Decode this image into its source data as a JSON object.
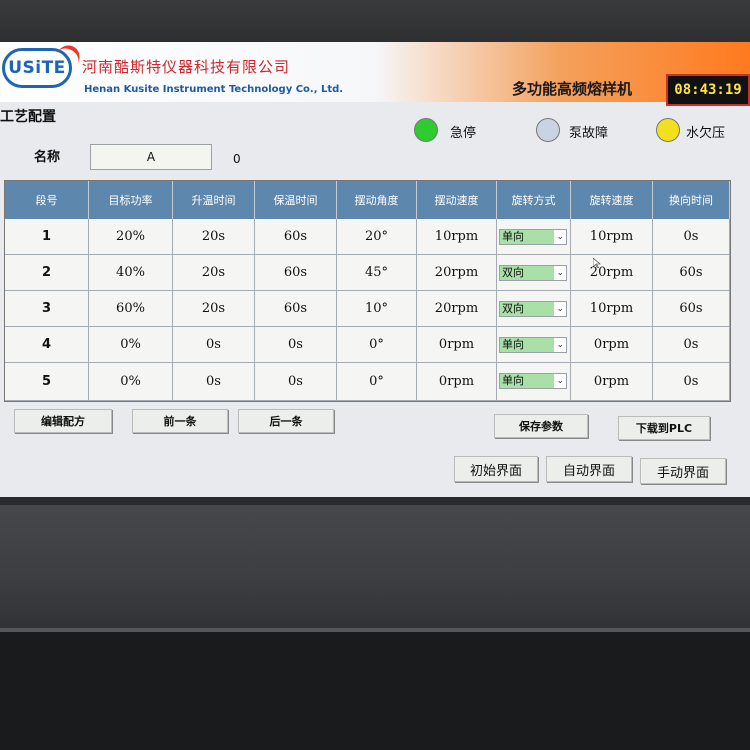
{
  "header": {
    "logo_text": "USiTE",
    "company_cn": "河南酷斯特仪器科技有限公司",
    "company_en": "Henan Kusite Instrument Technology Co., Ltd.",
    "machine_title": "多功能高频熔样机",
    "clock": "08:43:19"
  },
  "page_title": "工艺配置",
  "status": [
    {
      "label": "急停",
      "color": "#2ecc2e"
    },
    {
      "label": "泵故障",
      "color": "#c9d4e2"
    },
    {
      "label": "水欠压",
      "color": "#f2e01e"
    }
  ],
  "recipe": {
    "name_label": "名称",
    "name_value": "A",
    "number": "0"
  },
  "table": {
    "headers": [
      "段号",
      "目标功率",
      "升温时间",
      "保温时间",
      "摆动角度",
      "摆动速度",
      "旋转方式",
      "旋转速度",
      "换向时间"
    ],
    "rows": [
      {
        "seg": "1",
        "power": "20%",
        "heat": "20s",
        "hold": "60s",
        "angle": "20°",
        "swing_speed": "10rpm",
        "mode": "单向",
        "rot_speed": "10rpm",
        "reverse": "0s"
      },
      {
        "seg": "2",
        "power": "40%",
        "heat": "20s",
        "hold": "60s",
        "angle": "45°",
        "swing_speed": "20rpm",
        "mode": "双向",
        "rot_speed": "20rpm",
        "reverse": "60s"
      },
      {
        "seg": "3",
        "power": "60%",
        "heat": "20s",
        "hold": "60s",
        "angle": "10°",
        "swing_speed": "20rpm",
        "mode": "双向",
        "rot_speed": "10rpm",
        "reverse": "60s"
      },
      {
        "seg": "4",
        "power": "0%",
        "heat": "0s",
        "hold": "0s",
        "angle": "0°",
        "swing_speed": "0rpm",
        "mode": "单向",
        "rot_speed": "0rpm",
        "reverse": "0s"
      },
      {
        "seg": "5",
        "power": "0%",
        "heat": "0s",
        "hold": "0s",
        "angle": "0°",
        "swing_speed": "0rpm",
        "mode": "单向",
        "rot_speed": "0rpm",
        "reverse": "0s"
      }
    ]
  },
  "buttons": {
    "edit": "编辑配方",
    "prev": "前一条",
    "next": "后一条",
    "save": "保存参数",
    "download": "下载到PLC",
    "home": "初始界面",
    "auto": "自动界面",
    "manual": "手动界面"
  }
}
